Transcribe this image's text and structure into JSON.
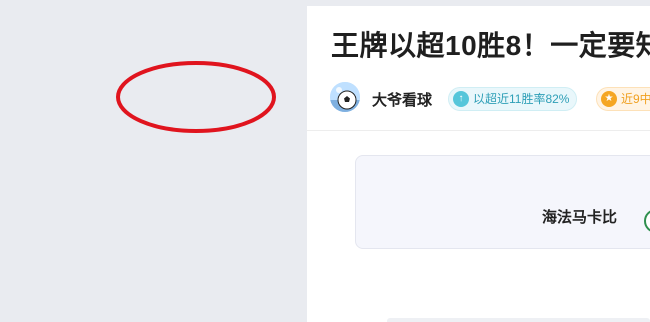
{
  "article": {
    "title": "王牌以超10胜8！一定要知",
    "author": {
      "name": "大爷看球"
    },
    "badges": {
      "win_rate": "以超近11胜率82%",
      "recent": "近9中"
    }
  },
  "match_card": {
    "home_team": "海法马卡比"
  },
  "colors": {
    "background": "#e9ebf0",
    "panel": "#ffffff",
    "badge_cyan": "#2e9fb7",
    "badge_orange": "#f0a020",
    "highlight_red": "#e0141e",
    "team_green": "#2f8f4e"
  },
  "icons": {
    "win_rate_badge": "arrow-up-icon",
    "recent_badge": "star-icon",
    "avatar": "soccer-ball-avatar"
  }
}
